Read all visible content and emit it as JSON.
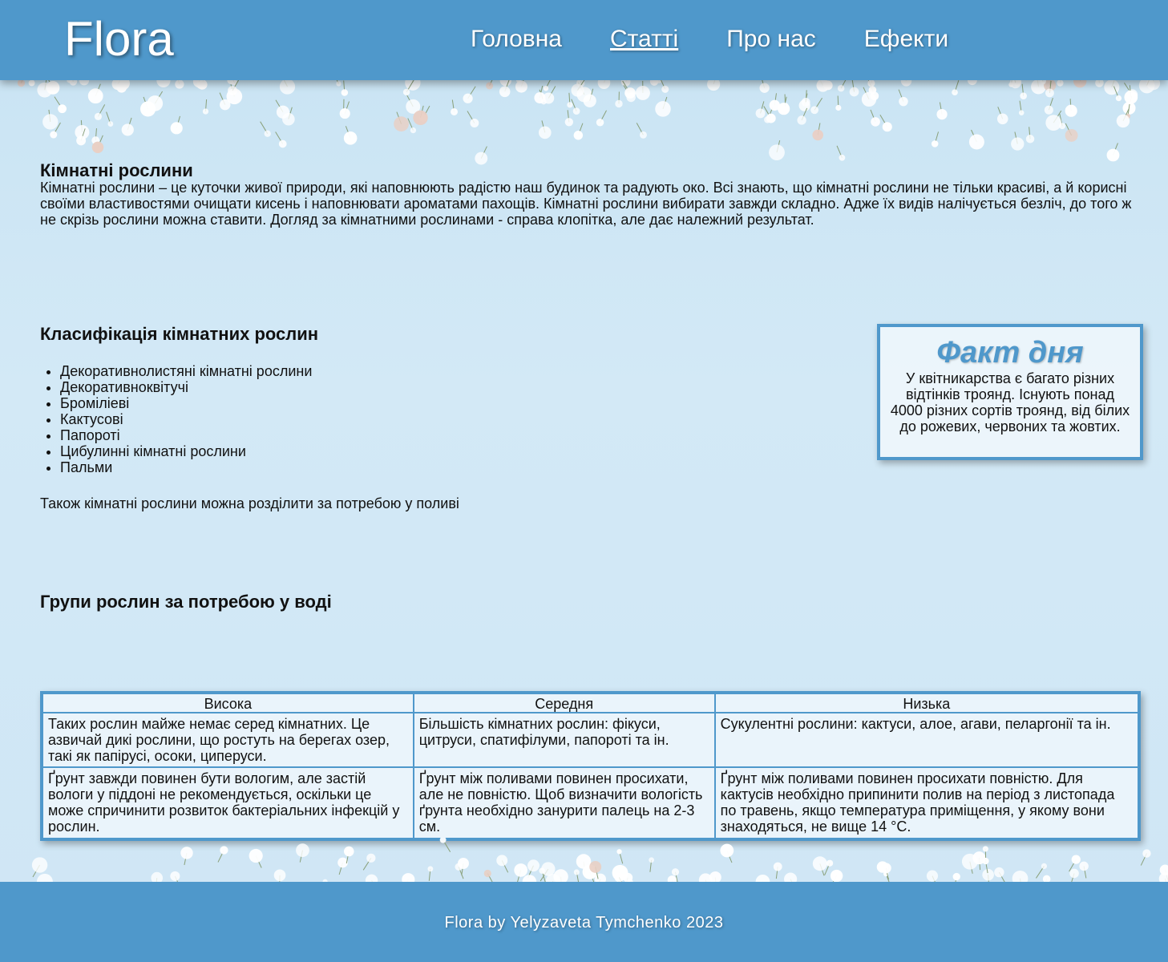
{
  "header": {
    "logo": "Flora",
    "nav": [
      {
        "label": "Головна",
        "active": false
      },
      {
        "label": "Статті",
        "active": true
      },
      {
        "label": "Про нас",
        "active": false
      },
      {
        "label": "Ефекти",
        "active": false
      }
    ]
  },
  "intro": {
    "title": "Кімнатні рослини",
    "text": "Кімнатні рослини – це куточки живої природи, які наповнюють радістю наш будинок та радують око. Всі знають, що кімнатні рослини не тільки красиві, а й корисні своїми властивостями очищати кисень і наповнювати ароматами пахощів. Кімнатні рослини вибирати завжди складно. Адже їх видів налічується безліч, до того ж не скрізь рослини можна ставити. Догляд за кімнатними рослинами - справа клопітка, але дає належний результат."
  },
  "classification": {
    "title": "Класифікація кімнатних рослин",
    "items": [
      "Декоративнолистяні кімнатні рослини",
      "Декоративноквітучі",
      "Броміліеві",
      "Кактусові",
      "Папороті",
      "Цибулинні кімнатні рослини",
      "Пальми"
    ],
    "note": "Також кімнатні рослини можна розділити за потребою у поливі"
  },
  "fact": {
    "title": "Факт дня",
    "text": "У квітникарства є багато різних відтінків троянд. Існують понад 4000 різних сортів троянд, від білих до рожевих, червоних та жовтих."
  },
  "groups": {
    "title": "Групи рослин за потребою у воді",
    "headers": [
      "Висока",
      "Середня",
      "Низька"
    ],
    "rows": [
      [
        "Таких рослин майже немає серед кімнатних. Це азвичай дикі рослини, що ростуть на берегах озер, такі як папірусі, осоки, циперуси.",
        "Більшість кімнатних рослин: фікуси, цитруси, спатифілуми, папороті та ін.",
        "Сукулентні рослини: кактуси, алое, агави, пеларгонії та ін."
      ],
      [
        "Ґрунт завжди повинен бути вологим, але застій вологи у піддоні не рекомендується, оскільки це може спричинити розвиток бактеріальних інфекцій у рослин.",
        "Ґрунт між поливами повинен просихати, але не повністю. Щоб визначити вологість ґрунта необхідно занурити палець на 2-3 см.",
        "Ґрунт між поливами повинен просихати повністю. Для кактусів необхідно припинити полив на період з листопада по травень, якщо температура приміщення, у якому вони знаходяться, не вище 14 °С."
      ]
    ]
  },
  "footer": {
    "text": "Flora by Yelyzaveta Tymchenko 2023"
  },
  "colors": {
    "accent": "#4f98cb",
    "background": "#cfe6f5",
    "header_text": "#ffffff"
  }
}
